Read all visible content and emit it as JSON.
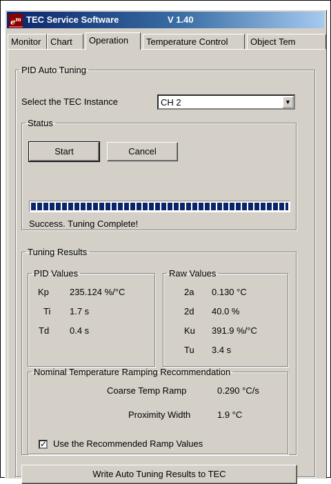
{
  "window": {
    "title": "TEC Service Software",
    "version": "V 1.40",
    "icon_text": "e"
  },
  "tabs": [
    "Monitor",
    "Chart",
    "Operation",
    "Temperature Control",
    "Object Tem"
  ],
  "active_tab": "Operation",
  "pid_auto_tuning": {
    "legend": "PID Auto Tuning",
    "select_label": "Select the TEC Instance",
    "selected_instance": "CH 2",
    "status": {
      "legend": "Status",
      "start_label": "Start",
      "cancel_label": "Cancel",
      "progress_fraction": 1.0,
      "message": "Success. Tuning Complete!"
    },
    "results": {
      "legend": "Tuning Results",
      "pid_values": {
        "legend": "PID Values",
        "rows": [
          {
            "name": "Kp",
            "value": "235.124 %/°C"
          },
          {
            "name": "Ti",
            "value": "1.7 s"
          },
          {
            "name": "Td",
            "value": "0.4 s"
          }
        ]
      },
      "raw_values": {
        "legend": "Raw Values",
        "rows": [
          {
            "name": "2a",
            "value": "0.130 °C"
          },
          {
            "name": "2d",
            "value": "40.0 %"
          },
          {
            "name": "Ku",
            "value": "391.9 %/°C"
          },
          {
            "name": "Tu",
            "value": "3.4 s"
          }
        ]
      },
      "ramping": {
        "legend": "Nominal Temperature Ramping Recommendation",
        "coarse_label": "Coarse Temp Ramp",
        "coarse_value": "0.290 °C/s",
        "proximity_label": "Proximity Width",
        "proximity_value": "1.9 °C",
        "use_recommended_label": "Use the Recommended Ramp Values",
        "use_recommended_checked": true
      }
    },
    "write_button_label": "Write Auto Tuning Results to TEC"
  }
}
